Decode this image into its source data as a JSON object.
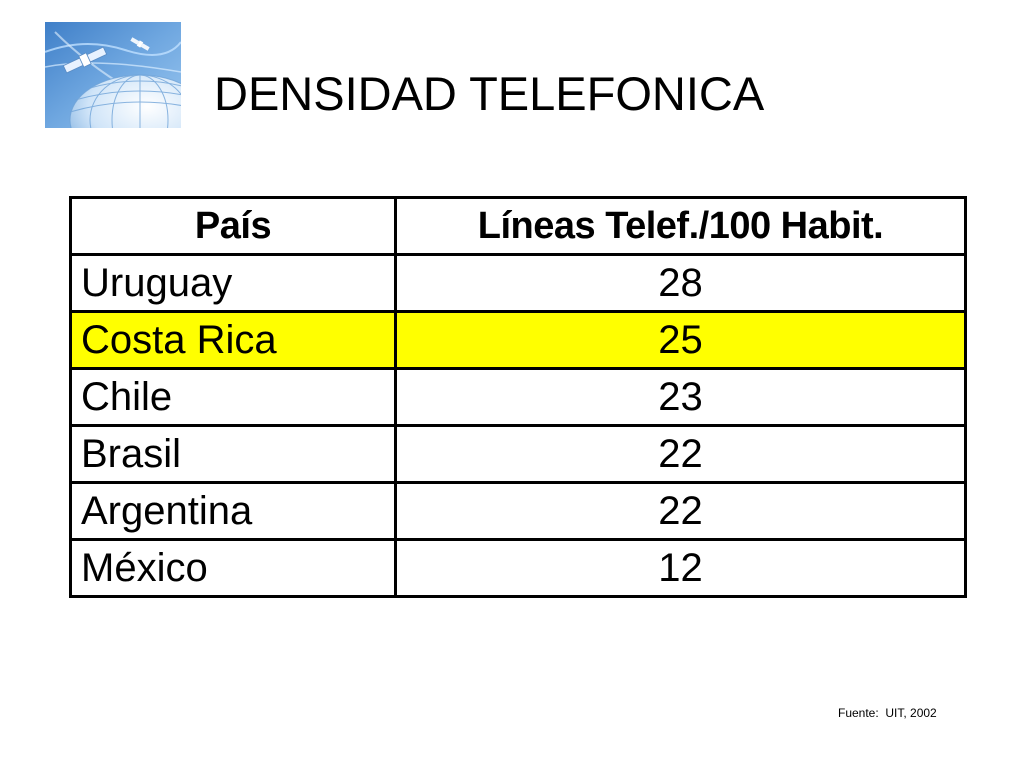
{
  "slide": {
    "title": "DENSIDAD TELEFONICA",
    "logo_icon": "globe-satellite-icon",
    "source": "Fuente:  UIT, 2002"
  },
  "table": {
    "headers": [
      "País",
      "Líneas Telef./100 Habit."
    ],
    "highlight_color": "#ffff00",
    "rows": [
      {
        "country": "Uruguay",
        "value": "28",
        "highlight": false
      },
      {
        "country": "Costa Rica",
        "value": "25",
        "highlight": true
      },
      {
        "country": "Chile",
        "value": "23",
        "highlight": false
      },
      {
        "country": "Brasil",
        "value": "22",
        "highlight": false
      },
      {
        "country": "Argentina",
        "value": "22",
        "highlight": false
      },
      {
        "country": "México",
        "value": "12",
        "highlight": false
      }
    ]
  }
}
